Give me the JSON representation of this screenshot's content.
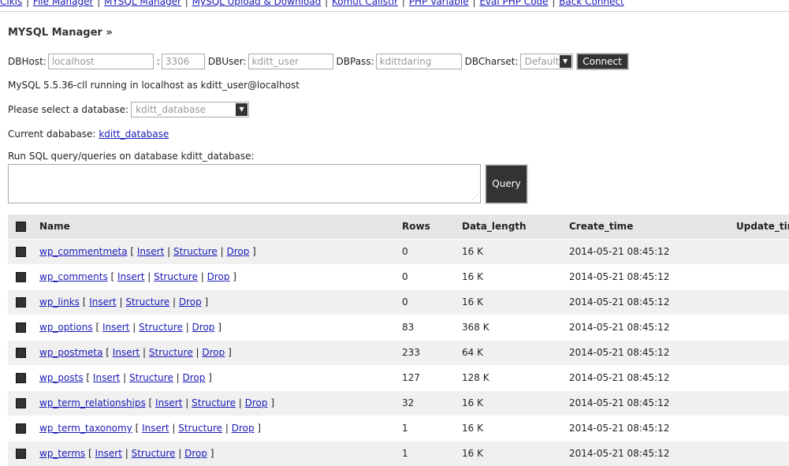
{
  "topmenu": {
    "items": [
      "Cikis",
      "File Manager",
      "MYSQL Manager",
      "MySQL Upload & Download",
      "Komut Calistir",
      "PHP Variable",
      "Eval PHP Code",
      "Back Connect"
    ]
  },
  "title": "MYSQL Manager »",
  "connect": {
    "dbhost_label": "DBHost:",
    "dbhost_value": "localhost",
    "port_sep": ":",
    "port_value": "3306",
    "dbuser_label": "DBUser:",
    "dbuser_value": "kditt_user",
    "dbpass_label": "DBPass:",
    "dbpass_value": "kdittdaring",
    "charset_label": "DBCharset:",
    "charset_value": "Default",
    "connect_label": "Connect"
  },
  "status_text": "MySQL 5.5.36-cll running in localhost as kditt_user@localhost",
  "db_select": {
    "label": "Please select a database:",
    "value": "kditt_database"
  },
  "current": {
    "label": "Current dababase:",
    "db": "kditt_database"
  },
  "query": {
    "label": "Run SQL query/queries on database kditt_database:",
    "button": "Query"
  },
  "table": {
    "headers": [
      "Name",
      "Rows",
      "Data_length",
      "Create_time",
      "Update_time"
    ],
    "actions": [
      "Insert",
      "Structure",
      "Drop"
    ],
    "rows": [
      {
        "name": "wp_commentmeta",
        "rows": "0",
        "data_length": "16 K",
        "create_time": "2014-05-21 08:45:12"
      },
      {
        "name": "wp_comments",
        "rows": "0",
        "data_length": "16 K",
        "create_time": "2014-05-21 08:45:12"
      },
      {
        "name": "wp_links",
        "rows": "0",
        "data_length": "16 K",
        "create_time": "2014-05-21 08:45:12"
      },
      {
        "name": "wp_options",
        "rows": "83",
        "data_length": "368 K",
        "create_time": "2014-05-21 08:45:12"
      },
      {
        "name": "wp_postmeta",
        "rows": "233",
        "data_length": "64 K",
        "create_time": "2014-05-21 08:45:12"
      },
      {
        "name": "wp_posts",
        "rows": "127",
        "data_length": "128 K",
        "create_time": "2014-05-21 08:45:12"
      },
      {
        "name": "wp_term_relationships",
        "rows": "32",
        "data_length": "16 K",
        "create_time": "2014-05-21 08:45:12"
      },
      {
        "name": "wp_term_taxonomy",
        "rows": "1",
        "data_length": "16 K",
        "create_time": "2014-05-21 08:45:12"
      },
      {
        "name": "wp_terms",
        "rows": "1",
        "data_length": "16 K",
        "create_time": "2014-05-21 08:45:12"
      }
    ]
  }
}
